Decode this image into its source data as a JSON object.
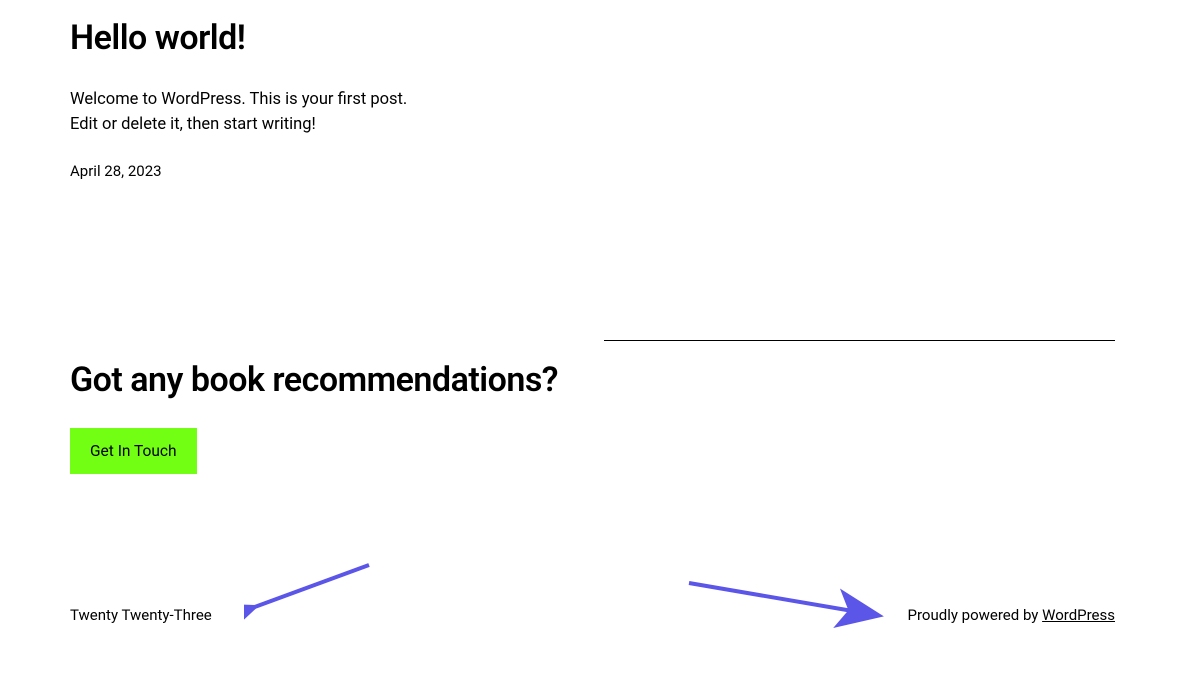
{
  "post": {
    "title": "Hello world!",
    "excerpt_line1": "Welcome to WordPress. This is your first post.",
    "excerpt_line2": "Edit or delete it, then start writing!",
    "date": "April 28, 2023"
  },
  "cta": {
    "heading": "Got any book recommendations?",
    "button_label": "Get In Touch"
  },
  "footer": {
    "site_title": "Twenty Twenty-Three",
    "powered_prefix": "Proudly powered by ",
    "powered_link": "WordPress"
  },
  "colors": {
    "accent": "#72ff13",
    "arrow": "#5b55e8"
  }
}
